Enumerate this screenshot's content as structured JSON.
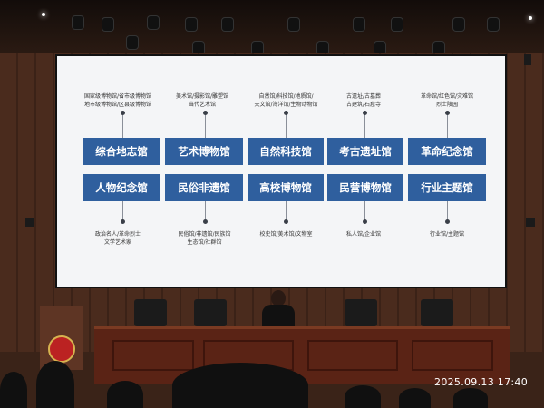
{
  "slide": {
    "top_row_notes": [
      "国家级博物馆/省市级博物馆\n地市级博物馆/区县级博物馆",
      "美术馆/摄影馆/雕塑馆\n当代艺术馆",
      "自然馆/科技馆/地质馆/\n天文馆/海洋馆/生物动物馆",
      "古遗址/古墓葬\n古建筑/石窟寺",
      "革命馆/红色馆/灾难馆\n烈士陵园"
    ],
    "row1_boxes": [
      "综合地志馆",
      "艺术博物馆",
      "自然科技馆",
      "考古遗址馆",
      "革命纪念馆"
    ],
    "row2_boxes": [
      "人物纪念馆",
      "民俗非遗馆",
      "高校博物馆",
      "民营博物馆",
      "行业主题馆"
    ],
    "bottom_row_notes": [
      "政治名人/革命烈士\n文学艺术家",
      "民俗馆/非遗馆/民族馆\n生态馆/社群馆",
      "校史馆/美术馆/文物室",
      "私人馆/企业馆",
      "行业馆/主题馆"
    ],
    "box_color": "#2f5f9e"
  },
  "photo": {
    "timestamp": "2025.09.13 17:40"
  }
}
